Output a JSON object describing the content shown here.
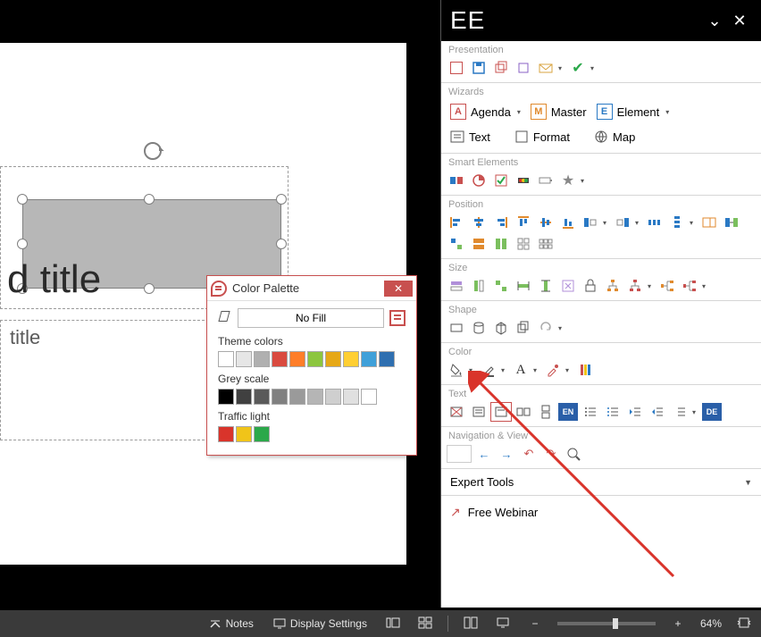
{
  "slide": {
    "title_fragment": "d title",
    "subtitle_placeholder": "title"
  },
  "palette": {
    "title": "Color Palette",
    "no_fill": "No Fill",
    "labels": {
      "theme": "Theme colors",
      "grey": "Grey scale",
      "traffic": "Traffic light"
    },
    "theme_colors": [
      "#ffffff",
      "#e6e6e6",
      "#b0b0b0",
      "#d94a3f",
      "#ff7e29",
      "#8cc63f",
      "#e6a817",
      "#ffcf33",
      "#3fa0d9",
      "#2f6fb0"
    ],
    "grey_colors": [
      "#000000",
      "#404040",
      "#5a5a5a",
      "#808080",
      "#9a9a9a",
      "#b5b5b5",
      "#cfcfcf",
      "#e0e0e0",
      "#ffffff"
    ],
    "traffic_colors": [
      "#d9342b",
      "#f0c419",
      "#2ba84a"
    ]
  },
  "panel": {
    "logo": "EE",
    "groups": {
      "presentation": "Presentation",
      "wizards": "Wizards",
      "smart": "Smart Elements",
      "position": "Position",
      "size": "Size",
      "shape": "Shape",
      "color": "Color",
      "text": "Text",
      "nav": "Navigation & View"
    },
    "wizards": {
      "agenda": "Agenda",
      "master": "Master",
      "element": "Element",
      "text": "Text",
      "format": "Format",
      "map": "Map"
    },
    "expert": "Expert Tools",
    "webinar": "Free Webinar",
    "text_lang_badge_1": "EN",
    "text_lang_badge_2": "DE"
  },
  "status": {
    "notes": "Notes",
    "display": "Display Settings",
    "zoom_pct": "64%"
  }
}
